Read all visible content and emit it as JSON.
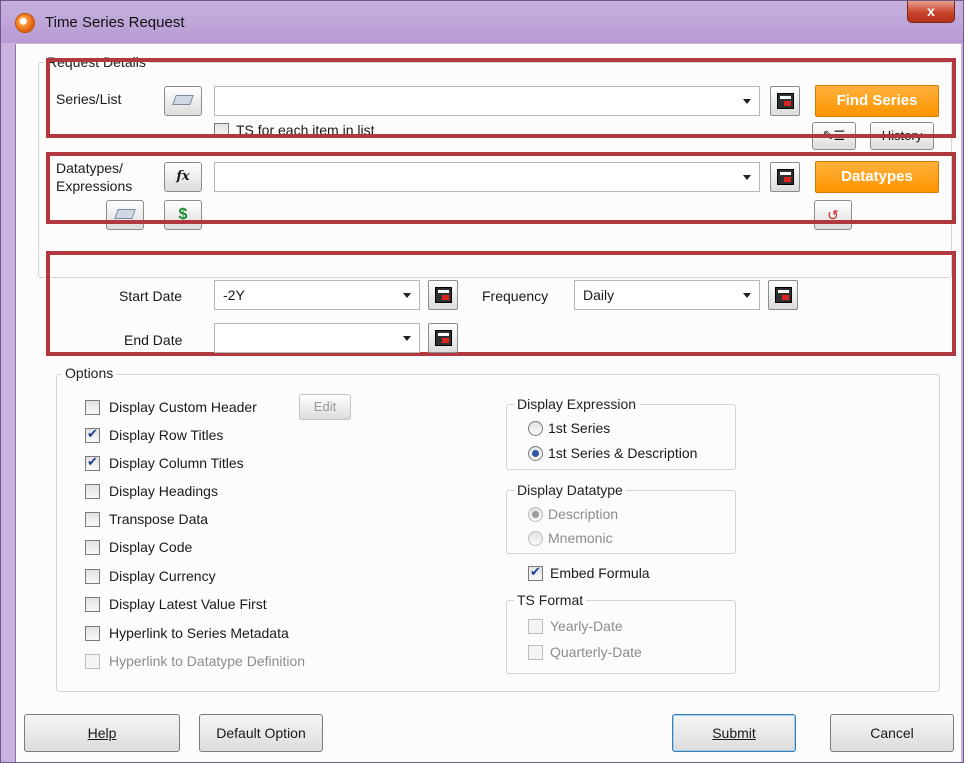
{
  "window": {
    "title": "Time Series Request",
    "close_glyph": "x",
    "app_icon": "orange-circle-icon"
  },
  "request_details": {
    "legend": "Request Details",
    "series_label": "Series/List",
    "series_value": "",
    "find_series_label": "Find Series",
    "ts_each_label": "TS for each item in list",
    "history_label": "History",
    "datatypes_label_1": "Datatypes/",
    "datatypes_label_2": "Expressions",
    "fx_label": "fx",
    "dollar_label": "$",
    "datatypes_value": "",
    "datatypes_button_label": "Datatypes"
  },
  "dates": {
    "start_label": "Start Date",
    "start_value": "-2Y",
    "end_label": "End Date",
    "end_value": "",
    "frequency_label": "Frequency",
    "frequency_value": "Daily"
  },
  "options": {
    "legend": "Options",
    "edit_label": "Edit",
    "checkboxes": [
      {
        "label": "Display Custom Header",
        "checked": false,
        "enabled": true
      },
      {
        "label": "Display Row Titles",
        "checked": true,
        "enabled": true
      },
      {
        "label": "Display Column Titles",
        "checked": true,
        "enabled": true
      },
      {
        "label": "Display Headings",
        "checked": false,
        "enabled": true
      },
      {
        "label": "Transpose Data",
        "checked": false,
        "enabled": true
      },
      {
        "label": "Display Code",
        "checked": false,
        "enabled": true
      },
      {
        "label": "Display Currency",
        "checked": false,
        "enabled": true
      },
      {
        "label": "Display Latest Value First",
        "checked": false,
        "enabled": true
      },
      {
        "label": "Hyperlink to Series Metadata",
        "checked": false,
        "enabled": true
      },
      {
        "label": "Hyperlink to Datatype Definition",
        "checked": false,
        "enabled": false
      }
    ],
    "display_expression": {
      "legend": "Display Expression",
      "options": [
        "1st Series",
        "1st Series & Description"
      ],
      "selected": "1st Series & Description"
    },
    "display_datatype": {
      "legend": "Display Datatype",
      "options": [
        "Description",
        "Mnemonic"
      ],
      "selected": "Description"
    },
    "embed_formula_label": "Embed Formula",
    "embed_formula_checked": true,
    "ts_format": {
      "legend": "TS Format",
      "options": [
        "Yearly-Date",
        "Quarterly-Date"
      ]
    }
  },
  "footer": {
    "help_label": "Help",
    "default_option_label": "Default Option",
    "submit_label": "Submit",
    "cancel_label": "Cancel"
  },
  "colors": {
    "accent_orange": "#ff9a12",
    "highlight_red": "#b0383e",
    "title_bar": "#c7b1de"
  }
}
